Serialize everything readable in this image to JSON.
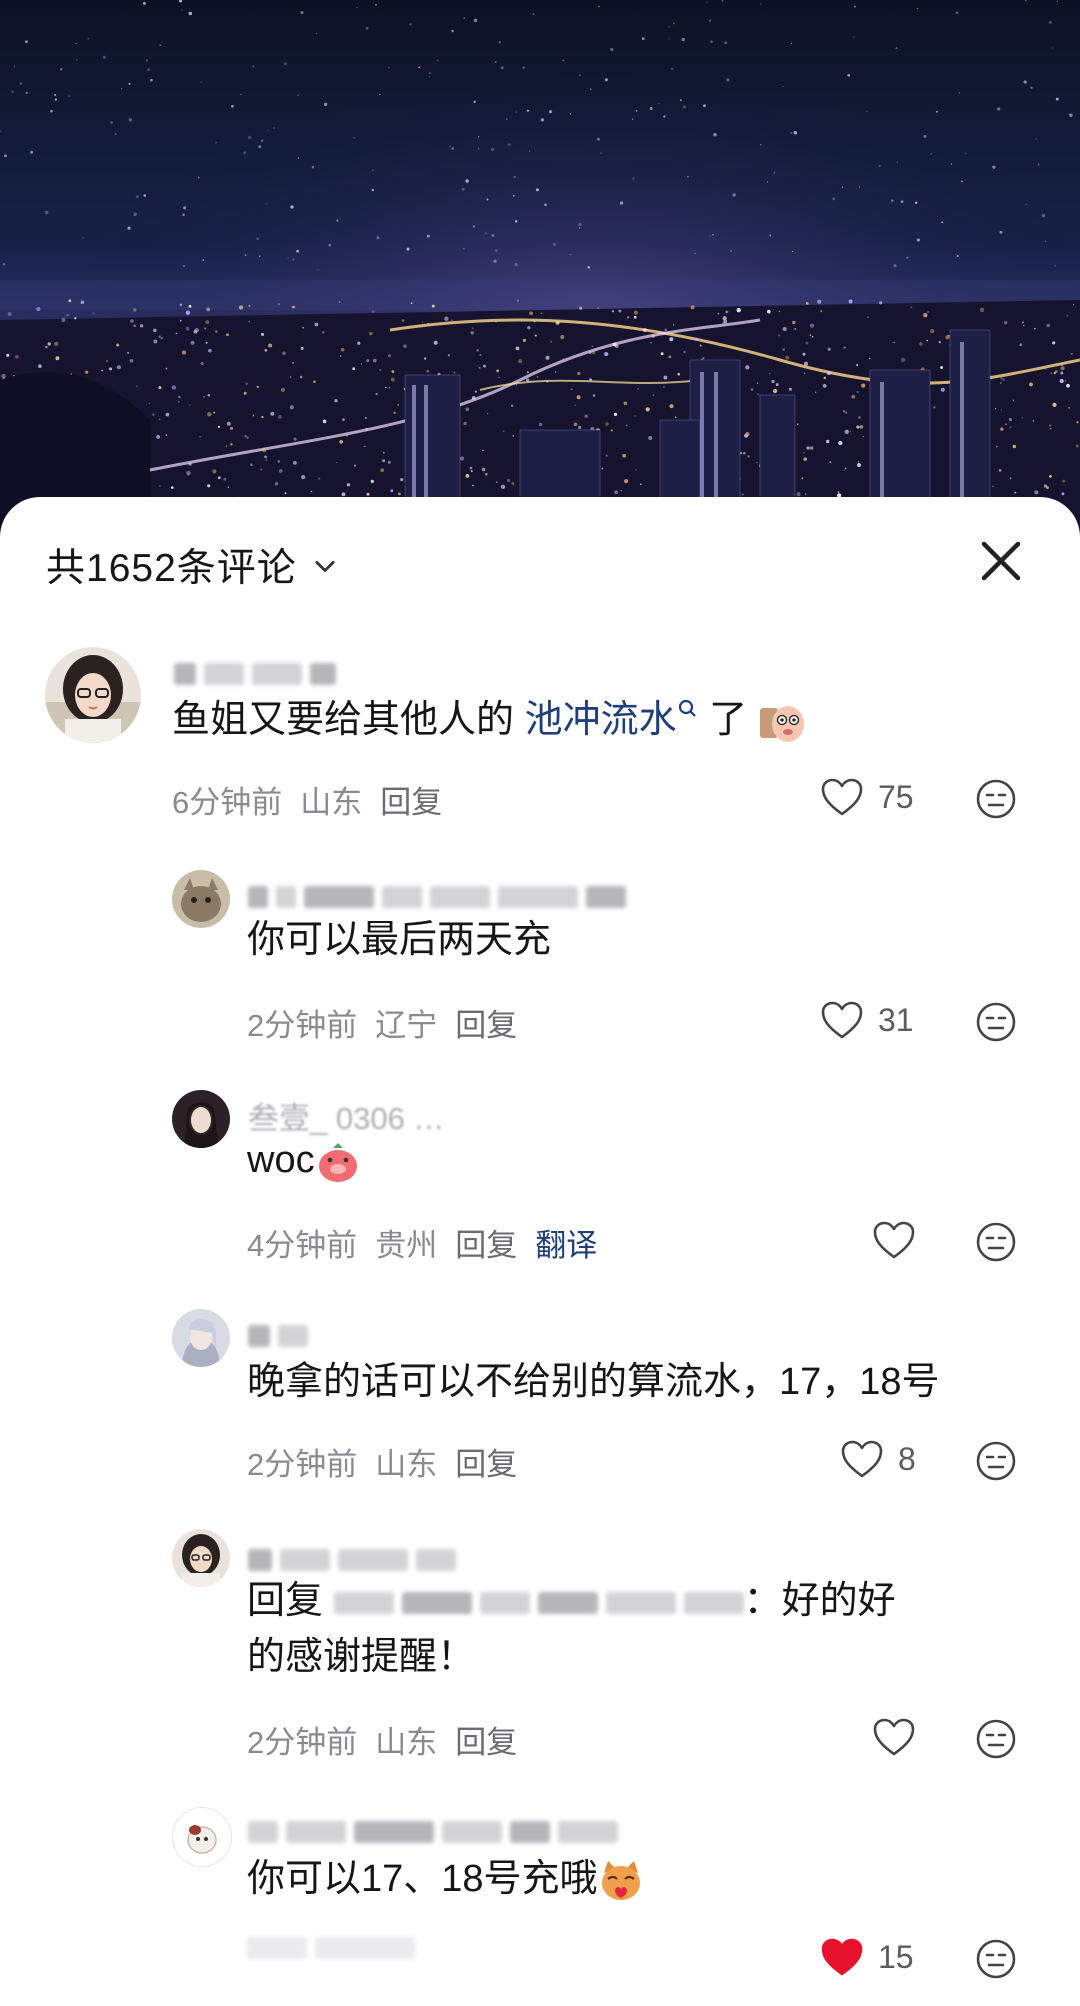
{
  "panel": {
    "title": "共1652条评论",
    "close_icon": "close-icon",
    "chevron_icon": "chevron-down-icon"
  },
  "comments": [
    {
      "text_main": "鱼姐又要给其他人的 ",
      "text_link": "池冲流水",
      "text_after": " 了",
      "time": "6分钟前",
      "location": "山东",
      "reply_label": "回复",
      "likes": "75",
      "liked": false
    },
    {
      "text": "你可以最后两天充",
      "time": "2分钟前",
      "location": "辽宁",
      "reply_label": "回复",
      "likes": "31",
      "liked": false
    },
    {
      "nick_partial": "叁壹_   0306    …",
      "text": "woc",
      "time": "4分钟前",
      "location": "贵州",
      "reply_label": "回复",
      "translate_label": "翻译",
      "likes": "",
      "liked": false
    },
    {
      "text": "晚拿的话可以不给别的算流水，17，18号",
      "time": "2分钟前",
      "location": "山东",
      "reply_label": "回复",
      "likes": "8",
      "liked": false
    },
    {
      "text_prefix": "回复",
      "text_suffix": "：好的好",
      "text_line2": "的感谢提醒！",
      "time": "2分钟前",
      "location": "山东",
      "reply_label": "回复",
      "likes": "",
      "liked": false
    },
    {
      "text": "你可以17、18号充哦",
      "likes": "15",
      "liked": true
    }
  ],
  "colors": {
    "link": "#1f3f7a",
    "meta": "#8a8a8f",
    "like_active": "#e8112d",
    "panel_bg": "#ffffff"
  }
}
